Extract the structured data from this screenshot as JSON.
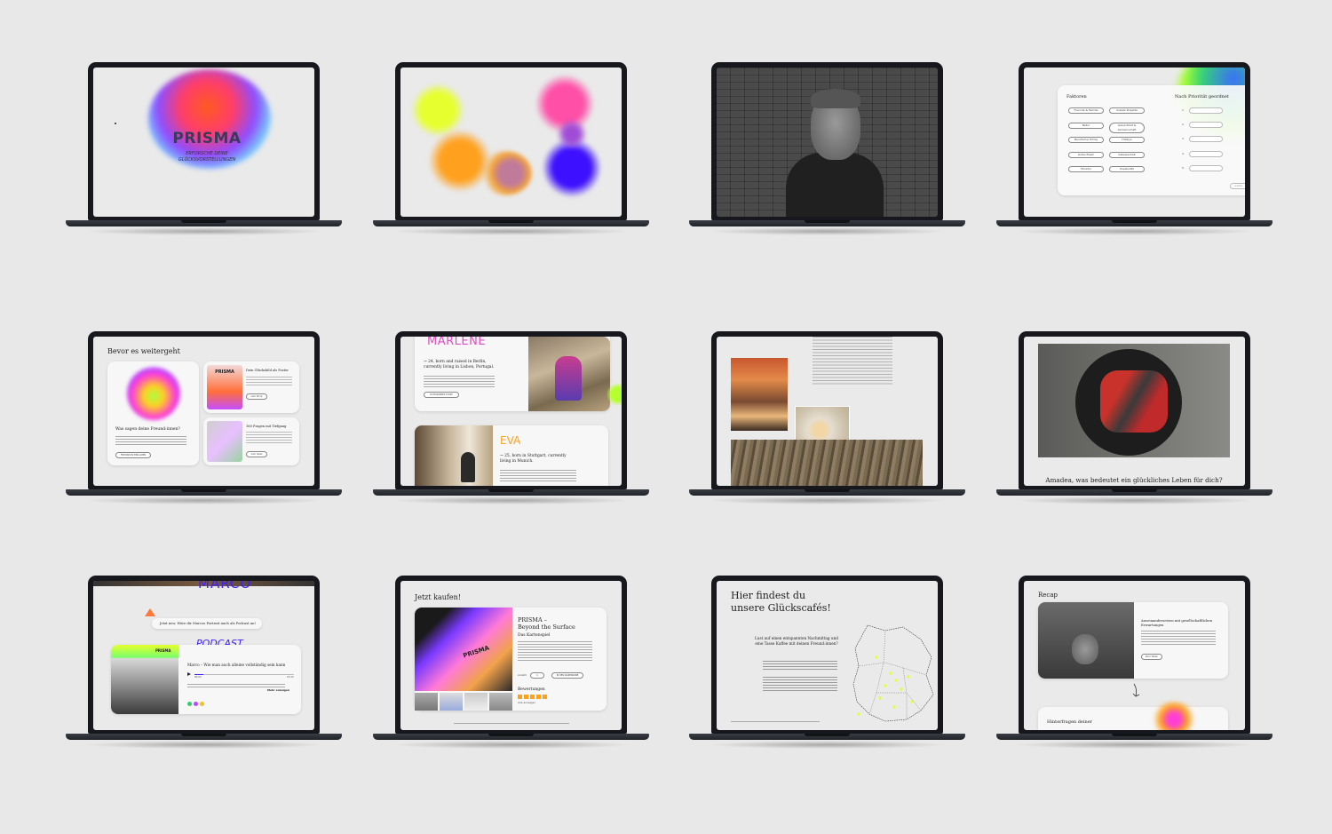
{
  "s1": {
    "logo": "PRISMA",
    "tagline_1": "ERFORSCHE DEINE",
    "tagline_2": "GLÜCKSVORSTELLUNGEN"
  },
  "s4": {
    "left_heading": "Faktoren",
    "right_heading": "Nach Priorität geordnet",
    "factors": [
      "Freunde & Familie",
      "Soziale Projekte",
      "Natur",
      "Gesundheit & Gemeinschaft",
      "Beruflicher Erfolg",
      "Hobbys",
      "Gutes Essen",
      "Gelassenheit",
      "Struktur",
      "Kreativität"
    ],
    "ranks": [
      "1.",
      "2.",
      "3.",
      "4.",
      "5."
    ],
    "button": "weiter"
  },
  "s5": {
    "title": "Bevor es weitergeht",
    "card_main_heading": "Was sagen deine Freund:innen?",
    "card_main_button": "FREUND:IN EINLADEN",
    "poster_logo": "PRISMA",
    "card_poster_heading": "Dein Glücksbild als Poster",
    "card_poster_button": "zum Shop",
    "card_questions_heading": "160 Fragen mit Tiefgang",
    "card_questions_button": "zum Spiel"
  },
  "s6": {
    "name1": "MARLENE",
    "story1": "→ 24, born and raised in Berlin, currently living in Lisbon, Portugal.",
    "button1": "ZU MARLENES STORY",
    "name2": "EVA",
    "story2": "→ 25, born in Stuttgart, currently living in Munich."
  },
  "s8": {
    "question": "Amadea, was bedeutet ein glückliches Leben für dich?"
  },
  "s9": {
    "name": "MARCO",
    "banner": "Jetzt neu: Höre dir Marcos Portrait auch als Podcast an!",
    "podcast": "PODCAST",
    "cover_logo": "PRISMA",
    "episode_title": "Marco – Wie man auch alleine vollständig sein kann",
    "time_start": "00:00",
    "time_end": "23:40",
    "more": "Mehr anzeigen"
  },
  "s10": {
    "title": "Jetzt kaufen!",
    "product_title_1": "PRISMA –",
    "product_title_2": "Beyond the Surface",
    "product_subtitle": "Das Kartenspiel",
    "box_logo": "PRISMA",
    "qty_label": "Anzahl",
    "qty": "1",
    "cart_button": "IN DEN WARENKORB",
    "reviews_heading": "Bewertungen",
    "reviews_link": "Alle anzeigen"
  },
  "s11": {
    "title_1": "Hier findest du",
    "title_2": "unsere Glückscafés!",
    "sub_1": "Lust auf einen entspannten Nachmittag und",
    "sub_2": "eine Tasse Kaffee mit deinen Freund:innen?"
  },
  "s12": {
    "title": "Recap",
    "card_heading": "Auseinandersetzen mit gesellschaftlichen Erwartungen",
    "card_button": "Zum Teilen",
    "card2_heading": "Hinterfragen deiner"
  },
  "colors": {
    "page_bg": "#e8e8e8",
    "laptop": "#16181d",
    "screen_bg": "#eaeaea"
  }
}
